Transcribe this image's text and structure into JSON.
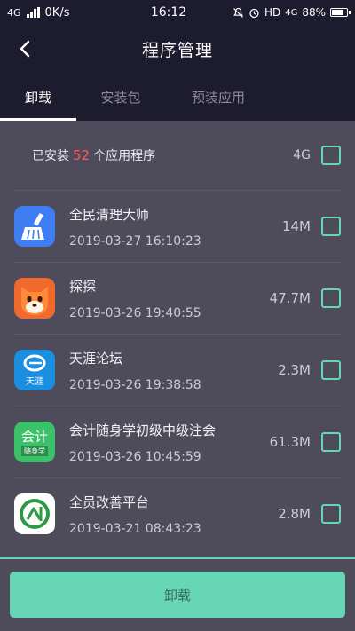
{
  "status_bar": {
    "network": "4G",
    "speed": "0K/s",
    "time": "16:12",
    "hd": "HD",
    "lte": "4G",
    "battery": "88%"
  },
  "header": {
    "title": "程序管理"
  },
  "tabs": [
    {
      "label": "卸载",
      "active": true
    },
    {
      "label": "安装包",
      "active": false
    },
    {
      "label": "预装应用",
      "active": false
    }
  ],
  "summary": {
    "prefix": "已安装",
    "count": "52",
    "suffix": "个应用程序",
    "total_size": "4G"
  },
  "apps": [
    {
      "name": "全民清理大师",
      "date": "2019-03-27 16:10:23",
      "size": "14M",
      "icon": "broom-icon",
      "color": "#3f7df2"
    },
    {
      "name": "探探",
      "date": "2019-03-26 19:40:55",
      "size": "47.7M",
      "icon": "fox-icon",
      "color": "#f06a2d"
    },
    {
      "name": "天涯论坛",
      "date": "2019-03-26 19:38:58",
      "size": "2.3M",
      "icon": "tianya-logo-icon",
      "color": "#1c8ee0",
      "icon_text": "天涯"
    },
    {
      "name": "会计随身学初级中级注会",
      "date": "2019-03-26 10:45:59",
      "size": "61.3M",
      "icon": "kuaiji-logo-icon",
      "color": "#3cc06a",
      "icon_text": "会计",
      "icon_subtext": "随身学"
    },
    {
      "name": "全员改善平台",
      "date": "2019-03-21 08:43:23",
      "size": "2.8M",
      "icon": "chuang-logo-icon",
      "color": "#ffffff"
    }
  ],
  "footer": {
    "uninstall_label": "卸载"
  },
  "colors": {
    "accent": "#67d6b5",
    "header_bg": "#1d1b2e",
    "body_bg": "#4e4b5a",
    "count_red": "#ff5a5f"
  }
}
